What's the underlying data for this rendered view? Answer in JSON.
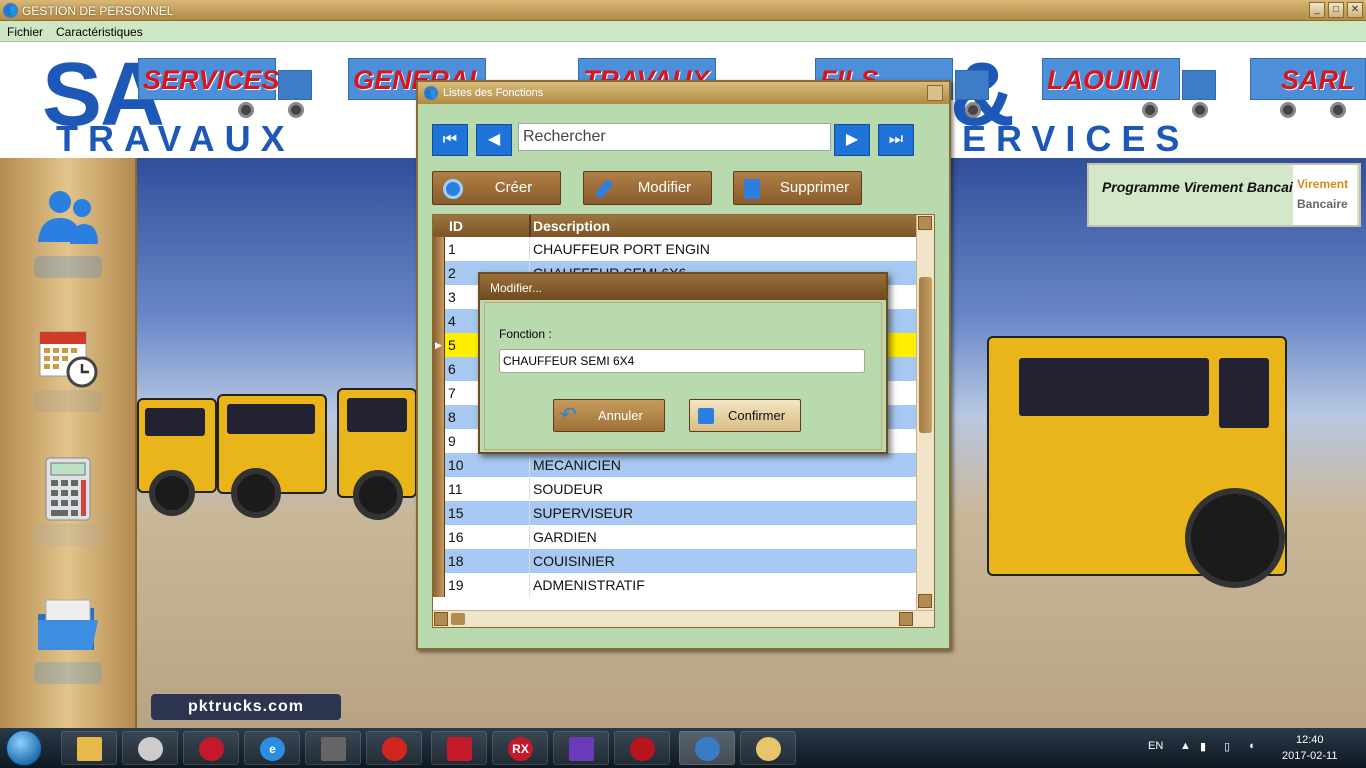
{
  "window": {
    "title": "GESTION DE PERSONNEL"
  },
  "menu": {
    "items": [
      "Fichier",
      "Caractéristiques"
    ]
  },
  "banner": {
    "big_left": "SA",
    "big_right": "&",
    "sub_left": "TRAVAUX",
    "sub_right": "ERVICES",
    "trucks": [
      "SERVICES",
      "GENERAL",
      "TRAVAUX",
      "FILS",
      "LAOUINI",
      "SARL"
    ]
  },
  "watermark": "pktrucks.com",
  "virement": {
    "label": "Programme Virement Bancaire",
    "logo_top": "Virement",
    "logo_bottom": "Bancaire"
  },
  "fonctions": {
    "title": "Listes des Fonctions",
    "search_value": "Rechercher",
    "buttons": {
      "create": "Créer",
      "modify": "Modifier",
      "delete": "Supprimer"
    },
    "columns": [
      "ID",
      "Description"
    ],
    "rows": [
      {
        "id": "1",
        "desc": "CHAUFFEUR PORT ENGIN"
      },
      {
        "id": "2",
        "desc": "CHAUFFEUR SEMI 6X6"
      },
      {
        "id": "3",
        "desc": ""
      },
      {
        "id": "4",
        "desc": ""
      },
      {
        "id": "5",
        "desc": ""
      },
      {
        "id": "6",
        "desc": ""
      },
      {
        "id": "7",
        "desc": ""
      },
      {
        "id": "8",
        "desc": ""
      },
      {
        "id": "9",
        "desc": ""
      },
      {
        "id": "10",
        "desc": "MECANICIEN"
      },
      {
        "id": "11",
        "desc": "SOUDEUR"
      },
      {
        "id": "15",
        "desc": "SUPERVISEUR"
      },
      {
        "id": "16",
        "desc": "GARDIEN"
      },
      {
        "id": "18",
        "desc": "COUISINIER"
      },
      {
        "id": "19",
        "desc": "ADMENISTRATIF"
      }
    ],
    "selected_index": 4
  },
  "dialog": {
    "title": "Modifier...",
    "label": "Fonction :",
    "value": "CHAUFFEUR SEMI 6X4",
    "cancel": "Annuler",
    "confirm": "Confirmer"
  },
  "taskbar": {
    "lang": "EN",
    "time": "12:40",
    "date": "2017-02-11",
    "rx_label": "RX"
  },
  "colors": {
    "accent_blue": "#1e73d8",
    "selected_row": "#ffee00",
    "alt_row": "#a7c8f0",
    "panel_green": "#b9d9ae",
    "brown": "#8a5b2c"
  }
}
